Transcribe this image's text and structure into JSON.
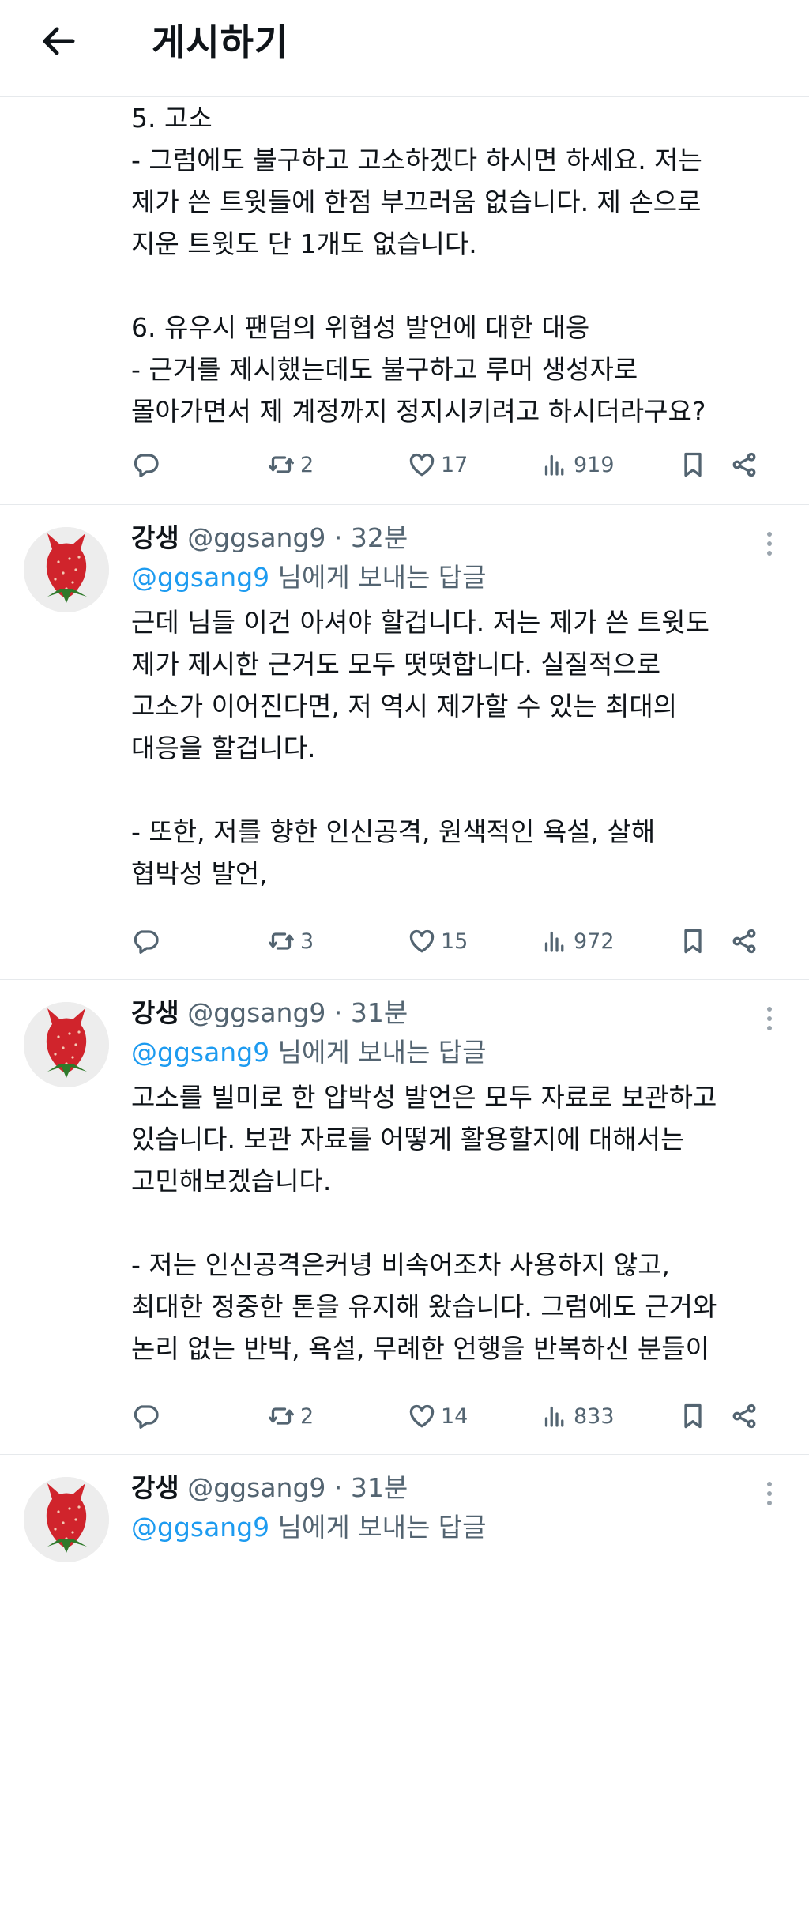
{
  "header": {
    "title": "게시하기"
  },
  "icons": {
    "back": "arrow-left-icon",
    "reply": "comment-icon",
    "retweet": "retweet-icon",
    "like": "heart-icon",
    "views": "views-chart-icon",
    "bookmark": "bookmark-icon",
    "share": "share-icon",
    "more": "more-vertical-icon"
  },
  "colors": {
    "mention": "#1d9bf0",
    "secondary_text": "#536471",
    "divider": "#e6e9ec"
  },
  "posts": [
    {
      "text": "5. 고소\n- 그럼에도 불구하고 고소하겠다 하시면 하세요. 저는\n제가 쓴 트윗들에 한점 부끄러움 없습니다. 제 손으로\n지운 트윗도 단 1개도 없습니다.\n\n6. 유우시 팬덤의 위협성 발언에 대한 대응\n- 근거를 제시했는데도 불구하고 루머 생성자로\n몰아가면서 제 계정까지 정지시키려고 하시더라구요?",
      "retweets": "2",
      "likes": "17",
      "views": "919"
    },
    {
      "name": "강생",
      "handle": "@ggsang9",
      "dot": "·",
      "time": "32분",
      "reply_mention": "@ggsang9",
      "reply_suffix": " 님에게 보내는 답글",
      "text": "근데 님들 이건 아셔야 할겁니다. 저는 제가 쓴 트윗도\n제가 제시한 근거도 모두 떳떳합니다. 실질적으로\n고소가 이어진다면, 저 역시 제가할 수 있는 최대의\n대응을 할겁니다.\n\n- 또한, 저를 향한 인신공격, 원색적인 욕설, 살해\n협박성 발언,",
      "retweets": "3",
      "likes": "15",
      "views": "972"
    },
    {
      "name": "강생",
      "handle": "@ggsang9",
      "dot": "·",
      "time": "31분",
      "reply_mention": "@ggsang9",
      "reply_suffix": " 님에게 보내는 답글",
      "text": "고소를 빌미로 한 압박성 발언은 모두 자료로 보관하고\n있습니다. 보관 자료를 어떻게 활용할지에 대해서는\n고민해보겠습니다.\n\n- 저는 인신공격은커녕 비속어조차 사용하지 않고,\n최대한 정중한 톤을 유지해 왔습니다. 그럼에도 근거와\n논리 없는 반박, 욕설, 무례한 언행을 반복하신 분들이",
      "retweets": "2",
      "likes": "14",
      "views": "833"
    },
    {
      "name": "강생",
      "handle": "@ggsang9",
      "dot": "·",
      "time": "31분",
      "reply_mention": "@ggsang9",
      "reply_suffix": " 님에게 보내는 답글"
    }
  ]
}
